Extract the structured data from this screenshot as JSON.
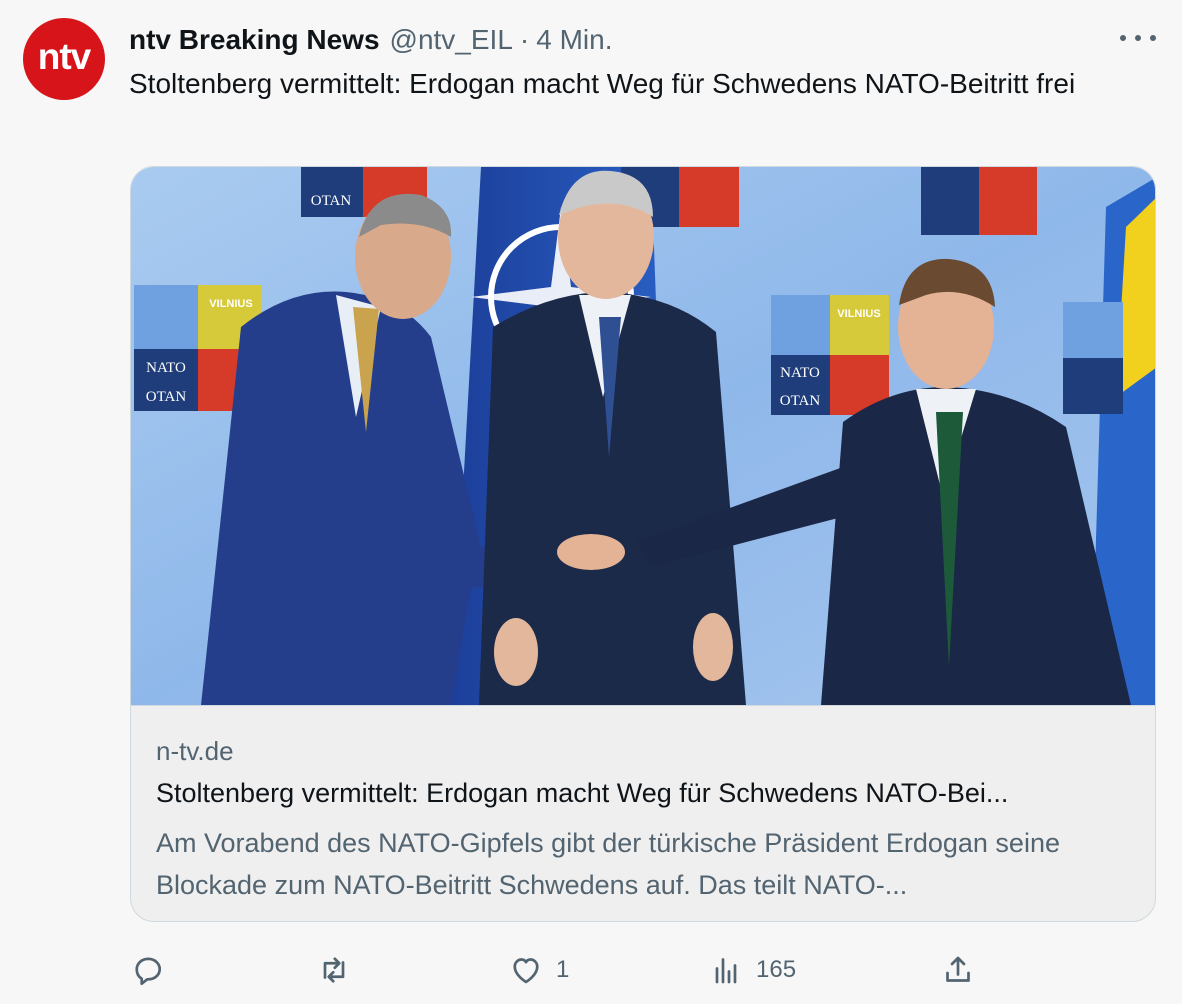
{
  "tweet": {
    "avatar_text": "ntv",
    "display_name": "ntv Breaking News",
    "handle": "@ntv_EIL",
    "separator": "·",
    "time": "4 Min.",
    "text": "Stoltenberg vermittelt: Erdogan macht Weg für Schwedens NATO-Beitritt frei",
    "more_icon": "more-dots-icon"
  },
  "card": {
    "image": {
      "backdrop_signs": [
        {
          "line1": "NATO",
          "line2": "OTAN",
          "event": "VILNIUS"
        },
        {
          "line1": "NATO",
          "line2": "OTAN",
          "event": "VILNIUS"
        }
      ]
    },
    "domain": "n-tv.de",
    "title": "Stoltenberg vermittelt: Erdogan macht Weg für Schwedens NATO-Bei...",
    "description": "Am Vorabend des NATO-Gipfels gibt der türkische Präsident Erdogan seine Blockade zum NATO-Beitritt Schwedens auf. Das teilt NATO-..."
  },
  "actions": {
    "reply_icon": "reply-icon",
    "retweet_icon": "retweet-icon",
    "like_icon": "heart-icon",
    "like_count": "1",
    "views_icon": "views-chart-icon",
    "view_count": "165",
    "share_icon": "share-icon"
  },
  "colors": {
    "brand_red": "#d7141a",
    "text_primary": "#0f1419",
    "text_secondary": "#536471",
    "border": "#cfd9de",
    "nato_blue": "#1f4fa8",
    "backdrop_blue": "#9fc3ec"
  }
}
